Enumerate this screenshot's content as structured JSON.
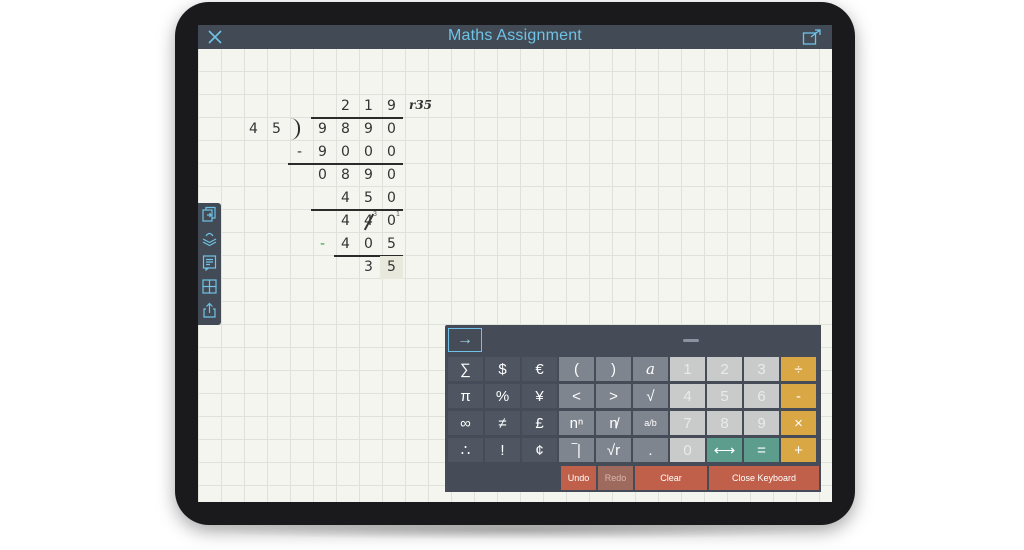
{
  "app": {
    "title": "Maths Assignment"
  },
  "toolbar": {
    "close_icon": "close-icon",
    "share_icon": "share-icon"
  },
  "sidebar": {
    "items": [
      {
        "icon": "copy-icon"
      },
      {
        "icon": "layers-icon"
      },
      {
        "icon": "notes-icon"
      },
      {
        "icon": "grid-icon"
      },
      {
        "icon": "share-out-icon"
      }
    ]
  },
  "worksheet": {
    "quotient": [
      "2",
      "1",
      "9"
    ],
    "remainder_label": "r35",
    "divisor": [
      "4",
      "5"
    ],
    "dividend": [
      "9",
      "8",
      "9",
      "0"
    ],
    "step1_sign": "-",
    "step1": [
      "9",
      "0",
      "0",
      "0"
    ],
    "step2": [
      "0",
      "8",
      "9",
      "0"
    ],
    "step3": [
      "4",
      "5",
      "0"
    ],
    "step4": [
      "4",
      "4",
      "0"
    ],
    "step4_carry_left": "3",
    "step4_carry_right": "1",
    "step5_sign": "-",
    "step5": [
      "4",
      "0",
      "5"
    ],
    "result": [
      "3",
      "5"
    ]
  },
  "keyboard": {
    "tab_key": "→",
    "rows": [
      [
        "∑",
        "$",
        "€",
        "(",
        ")",
        "a",
        "1",
        "2",
        "3",
        "÷"
      ],
      [
        "π",
        "%",
        "¥",
        "<",
        ">",
        "√",
        "4",
        "5",
        "6",
        "-"
      ],
      [
        "∞",
        "≠",
        "£",
        "nⁿ",
        "n̸",
        "a/b",
        "7",
        "8",
        "9",
        "×"
      ],
      [
        "∴",
        "!",
        "¢",
        "‾|",
        "√r",
        ".",
        "0",
        "⟷",
        "=",
        "+"
      ]
    ],
    "undo_label": "Undo",
    "redo_label": "Redo",
    "clear_label": "Clear",
    "close_label": "Close Keyboard"
  },
  "colors": {
    "accent": "#6ec3e6",
    "bar": "#424a55",
    "orange": "#d9a744",
    "teal": "#5d9d8e",
    "red": "#c0604a"
  }
}
